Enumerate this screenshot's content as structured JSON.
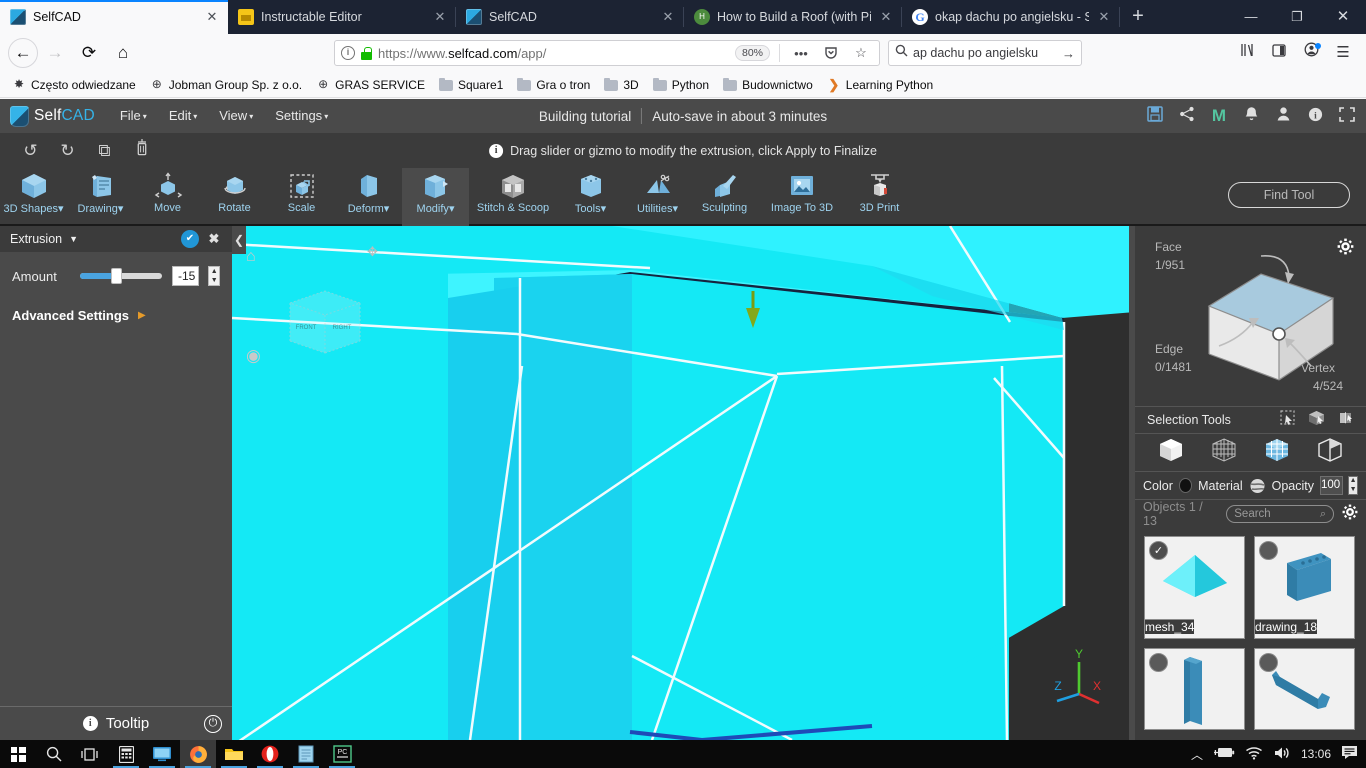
{
  "browser": {
    "tabs": [
      {
        "title": "SelfCAD",
        "favicon": "selfcad-icon",
        "active": true,
        "close": "✕"
      },
      {
        "title": "Instructable Editor",
        "favicon": "instructables-icon",
        "active": false,
        "close": "✕"
      },
      {
        "title": "SelfCAD",
        "favicon": "selfcad-icon",
        "active": false,
        "close": "✕"
      },
      {
        "title": "How to Build a Roof (with Pictu",
        "favicon": "wikihow-icon",
        "active": false,
        "close": "✕"
      },
      {
        "title": "okap dachu po angielsku - Szuk",
        "favicon": "google-icon",
        "active": false,
        "close": "✕"
      }
    ],
    "new_tab_label": "+",
    "window_controls": {
      "minimize": "—",
      "maximize": "❐",
      "close": "✕"
    },
    "nav": {
      "back": "←",
      "forward": "→",
      "reload": "⟳",
      "home": "⌂"
    },
    "url": {
      "prefix": "https://www.",
      "domain": "selfcad.com",
      "path": "/app/",
      "zoom": "80%"
    },
    "url_icons": {
      "info": "i",
      "lock": "lock-icon",
      "more": "•••",
      "pocket": "pocket-icon",
      "bookmark": "☆"
    },
    "search": {
      "value": "ap dachu po angielsku",
      "submit": "→",
      "icon": "search-icon"
    },
    "right_icons": {
      "library": "library-icon",
      "sidebar": "sidebar-icon",
      "account": "account-icon",
      "menu": "☰"
    },
    "bookmarks": [
      {
        "label": "Często odwiedzane",
        "icon": "gear-icon"
      },
      {
        "label": "Jobman Group Sp. z o.o.",
        "icon": "globe-icon"
      },
      {
        "label": "GRAS SERVICE",
        "icon": "globe-icon"
      },
      {
        "label": "Square1",
        "icon": "folder-icon"
      },
      {
        "label": "Gra o tron",
        "icon": "folder-icon"
      },
      {
        "label": "3D",
        "icon": "folder-icon"
      },
      {
        "label": "Python",
        "icon": "folder-icon"
      },
      {
        "label": "Budownictwo",
        "icon": "folder-icon"
      },
      {
        "label": "Learning Python",
        "icon": "chevron-icon"
      }
    ]
  },
  "app": {
    "brand": {
      "name_dark": "Self",
      "name_accent": "CAD"
    },
    "menus": [
      {
        "label": "File",
        "caret": "▾"
      },
      {
        "label": "Edit",
        "caret": "▾"
      },
      {
        "label": "View",
        "caret": "▾"
      },
      {
        "label": "Settings",
        "caret": "▾"
      }
    ],
    "project_title": "Building tutorial",
    "autosave": "Auto-save in about 3 minutes",
    "header_icons": [
      "save-icon",
      "share-icon",
      "magic-icon",
      "bell-icon",
      "user-icon",
      "info-icon",
      "fullscreen-icon"
    ],
    "header_icon_glyphs": [
      "⛃",
      "☲",
      "M",
      "🔔",
      "👤",
      "i",
      "⛶"
    ],
    "undo_bar": {
      "undo": "↺",
      "redo": "↻",
      "copy": "⧉",
      "delete": "🗑",
      "hint": "Drag slider or gizmo to modify the extrusion, click Apply to Finalize",
      "hint_icon": "i"
    },
    "tools": [
      {
        "label": "3D Shapes",
        "caret": "▾",
        "icon": "cube-icon",
        "active": false
      },
      {
        "label": "Drawing",
        "caret": "▾",
        "icon": "drawing-icon",
        "active": false
      },
      {
        "label": "Move",
        "caret": "",
        "icon": "move-icon",
        "active": false
      },
      {
        "label": "Rotate",
        "caret": "",
        "icon": "rotate-icon",
        "active": false
      },
      {
        "label": "Scale",
        "caret": "",
        "icon": "scale-icon",
        "active": false
      },
      {
        "label": "Deform",
        "caret": "▾",
        "icon": "deform-icon",
        "active": false
      },
      {
        "label": "Modify",
        "caret": "▾",
        "icon": "modify-icon",
        "active": true
      },
      {
        "label": "Stitch & Scoop",
        "caret": "",
        "icon": "stitch-icon",
        "active": false
      },
      {
        "label": "Tools",
        "caret": "▾",
        "icon": "tools-icon",
        "active": false
      },
      {
        "label": "Utilities",
        "caret": "▾",
        "icon": "utilities-icon",
        "active": false
      },
      {
        "label": "Sculpting",
        "caret": "",
        "icon": "sculpting-icon",
        "active": false
      },
      {
        "label": "Image To 3D",
        "caret": "",
        "icon": "image3d-icon",
        "active": false
      },
      {
        "label": "3D Print",
        "caret": "",
        "icon": "print-icon",
        "active": false
      }
    ],
    "find_tool_placeholder": "Find Tool",
    "left_panel": {
      "title": "Extrusion",
      "caret": "▼",
      "apply": "✔",
      "close": "✖",
      "amount_label": "Amount",
      "amount_value": "-15",
      "advanced_settings": "Advanced Settings",
      "advanced_caret": "▶",
      "tooltip_label": "Tooltip",
      "tooltip_icon": "i",
      "power_icon": "power-icon"
    },
    "right_panel": {
      "face_label": "Face",
      "face_value": "1/951",
      "edge_label": "Edge",
      "edge_value": "0/1481",
      "vertex_label": "Vertex",
      "vertex_value": "4/524",
      "gear": "gear-icon",
      "selection_tools_label": "Selection Tools",
      "selection_icons": [
        "rect-select-icon",
        "box-select-icon",
        "paint-select-icon"
      ],
      "mode_icons": [
        "object-mode-icon",
        "vertex-mode-icon",
        "face-mode-icon",
        "edge-mode-icon"
      ],
      "color_label": "Color",
      "color_value": "#111111",
      "material_label": "Material",
      "opacity_label": "Opacity",
      "opacity_value": "100",
      "objects_label": "Objects 1 / 13",
      "search_placeholder": "Search",
      "objects": [
        {
          "name": "mesh_34",
          "selected": true,
          "shape": "pyramid"
        },
        {
          "name": "drawing_18",
          "selected": false,
          "shape": "wall"
        },
        {
          "name": "",
          "selected": false,
          "shape": "column"
        },
        {
          "name": "",
          "selected": false,
          "shape": "beam"
        }
      ]
    },
    "viewport": {
      "collapse": "❮",
      "home_icon": "home-icon",
      "pan_icon": "pan-icon",
      "orbit_icon": "orbit-icon",
      "navcube_front": "FRONT",
      "navcube_right": "RIGHT",
      "axes": {
        "x": "X",
        "y": "Y",
        "z": "Z",
        "x_color": "#e03030",
        "y_color": "#4fc930",
        "z_color": "#1f9fe0"
      },
      "model_color": "#18e8f0",
      "background": "#2e2e2e"
    }
  },
  "taskbar": {
    "items": [
      "start-icon",
      "search-icon",
      "taskview-icon",
      "calculator-icon",
      "display-icon",
      "firefox-icon",
      "explorer-icon",
      "opera-icon",
      "notepad-icon",
      "pccleaner-icon"
    ],
    "time": "13:06",
    "tray": [
      "chevron-up-icon",
      "battery-icon",
      "wifi-icon",
      "volume-icon"
    ],
    "notifications": "notification-icon"
  }
}
